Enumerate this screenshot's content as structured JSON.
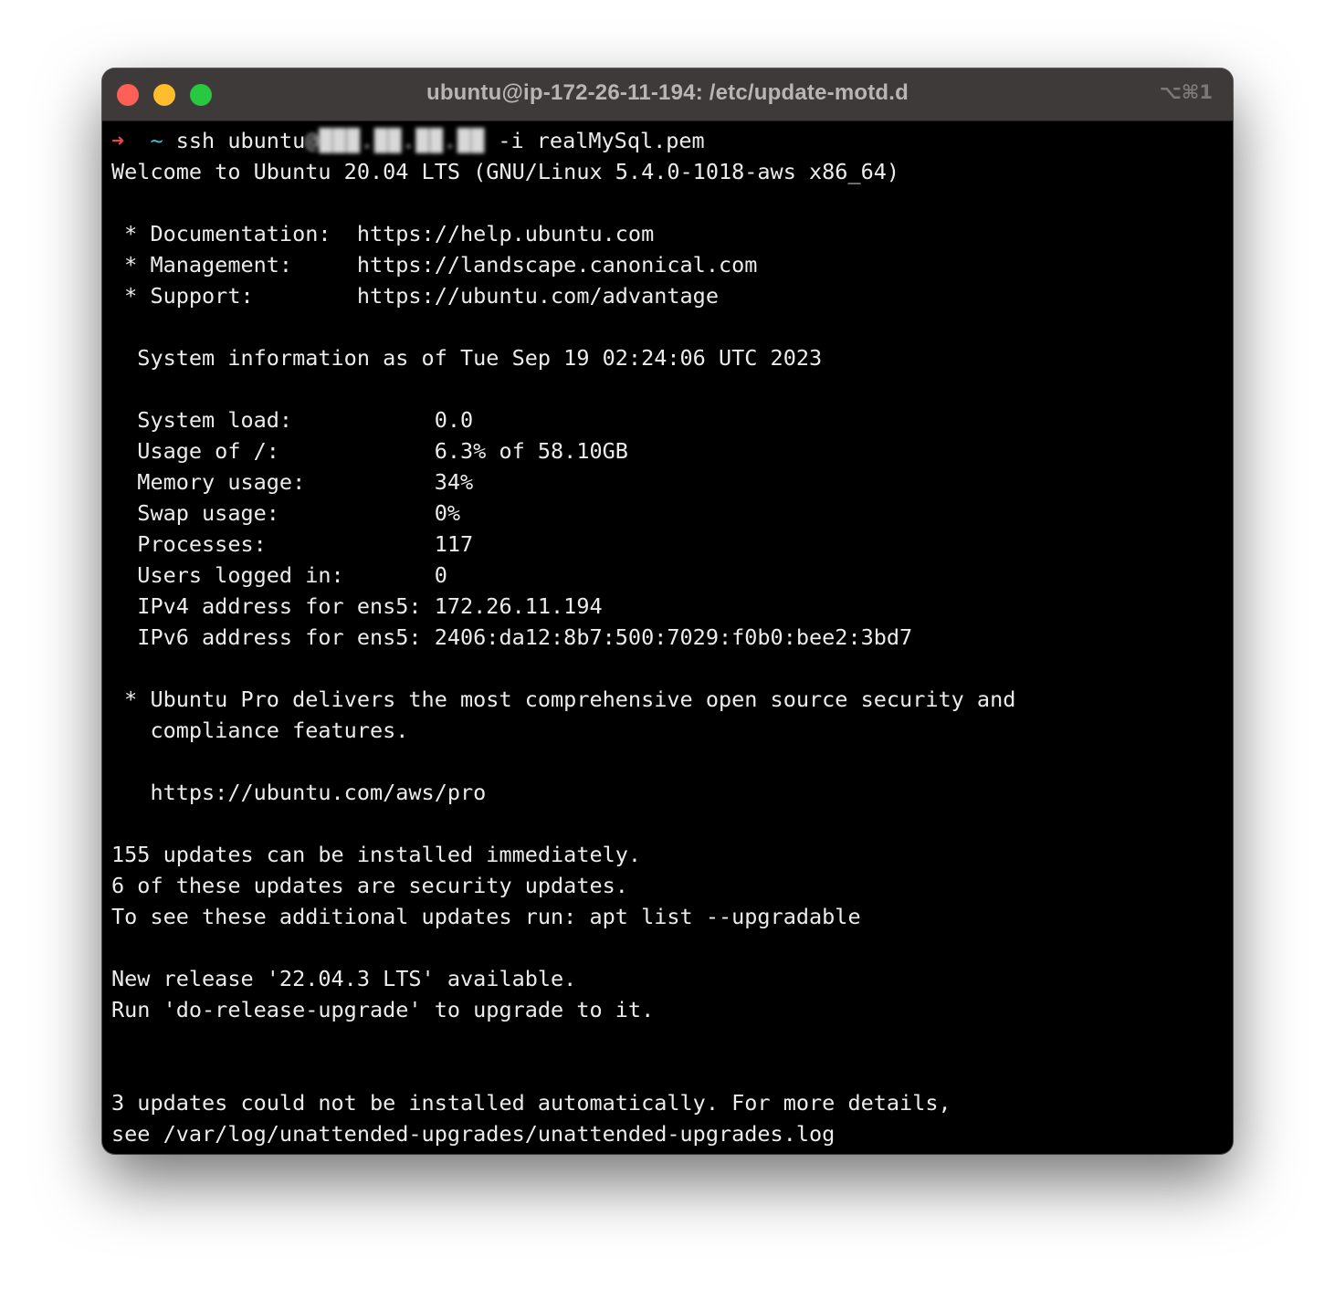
{
  "window": {
    "title": "ubuntu@ip-172-26-11-194: /etc/update-motd.d",
    "shortcut": "⌥⌘1"
  },
  "terminal": {
    "prompt": {
      "arrow": "➜",
      "cwd": "~",
      "command": " ssh ubuntu",
      "redacted_host": "@███.██.██.██",
      "args": " -i realMySql.pem"
    },
    "lines": [
      "Welcome to Ubuntu 20.04 LTS (GNU/Linux 5.4.0-1018-aws x86_64)",
      "",
      " * Documentation:  https://help.ubuntu.com",
      " * Management:     https://landscape.canonical.com",
      " * Support:        https://ubuntu.com/advantage",
      "",
      "  System information as of Tue Sep 19 02:24:06 UTC 2023",
      "",
      "  System load:           0.0",
      "  Usage of /:            6.3% of 58.10GB",
      "  Memory usage:          34%",
      "  Swap usage:            0%",
      "  Processes:             117",
      "  Users logged in:       0",
      "  IPv4 address for ens5: 172.26.11.194",
      "  IPv6 address for ens5: 2406:da12:8b7:500:7029:f0b0:bee2:3bd7",
      "",
      " * Ubuntu Pro delivers the most comprehensive open source security and",
      "   compliance features.",
      "",
      "   https://ubuntu.com/aws/pro",
      "",
      "155 updates can be installed immediately.",
      "6 of these updates are security updates.",
      "To see these additional updates run: apt list --upgradable",
      "",
      "New release '22.04.3 LTS' available.",
      "Run 'do-release-upgrade' to upgrade to it.",
      "",
      "",
      "3 updates could not be installed automatically. For more details,",
      "see /var/log/unattended-upgrades/unattended-upgrades.log"
    ]
  }
}
